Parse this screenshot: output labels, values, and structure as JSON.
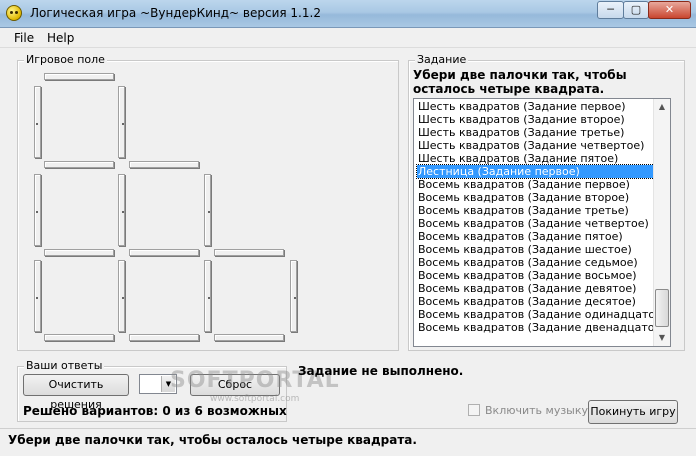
{
  "window": {
    "title": "Логическая игра ~ВундерКинд~ версия 1.1.2",
    "min": "─",
    "max": "▢",
    "close": "✕"
  },
  "menu": {
    "file": "File",
    "help": "Help"
  },
  "game_field": {
    "title": "Игровое поле"
  },
  "task": {
    "group_title": "Задание",
    "text": "Убери две палочки так, чтобы осталось четыре  квадрата.",
    "list_items": [
      "Шесть квадратов (Задание первое)",
      "Шесть квадратов (Задание второе)",
      "Шесть квадратов (Задание третье)",
      "Шесть квадратов (Задание четвертое)",
      "Шесть квадратов (Задание пятое)",
      "Лестница (Задание первое)",
      "Восемь квадратов (Задание первое)",
      "Восемь квадратов (Задание второе)",
      "Восемь квадратов (Задание третье)",
      "Восемь квадратов (Задание четвертое)",
      "Восемь квадратов (Задание пятое)",
      "Восемь квадратов (Задание шестое)",
      "Восемь квадратов (Задание седьмое)",
      "Восемь квадратов (Задание восьмое)",
      "Восемь квадратов (Задание девятое)",
      "Восемь квадратов (Задание десятое)",
      "Восемь квадратов (Задание одинадцатое)",
      "Восемь квадратов (Задание двенадцатое)"
    ],
    "selected_item": "Лестница (Задание первое)",
    "scroll_up": "▲",
    "scroll_down": "▼"
  },
  "answers": {
    "group_title": "Ваши ответы",
    "clear_button": "Очистить решения",
    "combo_value": "",
    "combo_arrow": "▼",
    "reset_button": "Сброс",
    "solved_text": "Решено вариантов: 0 из 6 возможных"
  },
  "result_status": "Задание не выполнено.",
  "music_checkbox": {
    "label": "Включить музыку",
    "checked": false
  },
  "quit_button": "Покинуть игру",
  "statusbar": {
    "text": "Убери две палочки так, чтобы осталось четыре  квадрата."
  },
  "watermark": {
    "text": "SOFTPORTAL",
    "sub": "www.softportal.com"
  }
}
